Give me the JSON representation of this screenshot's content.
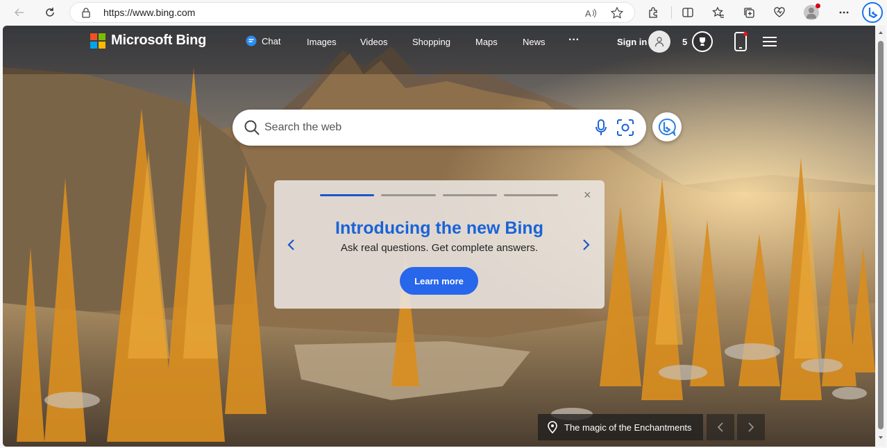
{
  "browser": {
    "url": "https://www.bing.com",
    "icons": [
      "back-icon",
      "refresh-icon",
      "lock-icon",
      "read-aloud-icon",
      "favorite-star-icon",
      "extensions-icon",
      "split-screen-icon",
      "favorites-icon",
      "collections-icon",
      "performance-icon",
      "profile-icon",
      "more-icon",
      "copilot-icon"
    ]
  },
  "header": {
    "logo_text": "Microsoft Bing",
    "nav": [
      "Chat",
      "Images",
      "Videos",
      "Shopping",
      "Maps",
      "News",
      "···"
    ],
    "signin": "Sign in",
    "rewards_count": "5"
  },
  "search": {
    "placeholder": "Search the web"
  },
  "promo": {
    "title": "Introducing the new Bing",
    "subtitle": "Ask real questions. Get complete answers.",
    "button": "Learn more",
    "close": "×",
    "slides": 4,
    "active_slide": 1
  },
  "caption": {
    "text": "The magic of the Enchantments"
  },
  "colors": {
    "accent": "#2866eb",
    "title_blue": "#1a63d8"
  }
}
